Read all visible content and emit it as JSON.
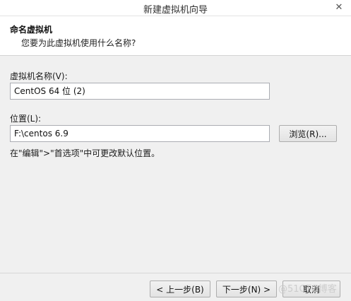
{
  "window": {
    "title": "新建虚拟机向导"
  },
  "header": {
    "title": "命名虚拟机",
    "subtitle": "您要为此虚拟机使用什么名称?"
  },
  "vm_name": {
    "label": "虚拟机名称(V):",
    "value": "CentOS 64 位 (2)"
  },
  "location": {
    "label": "位置(L):",
    "value": "F:\\centos 6.9",
    "browse_label": "浏览(R)..."
  },
  "hint": "在\"编辑\">\"首选项\"中可更改默认位置。",
  "footer": {
    "back_label": "< 上一步(B)",
    "next_label": "下一步(N) >",
    "cancel_label": "取消"
  },
  "watermark": "@51CTO博客"
}
